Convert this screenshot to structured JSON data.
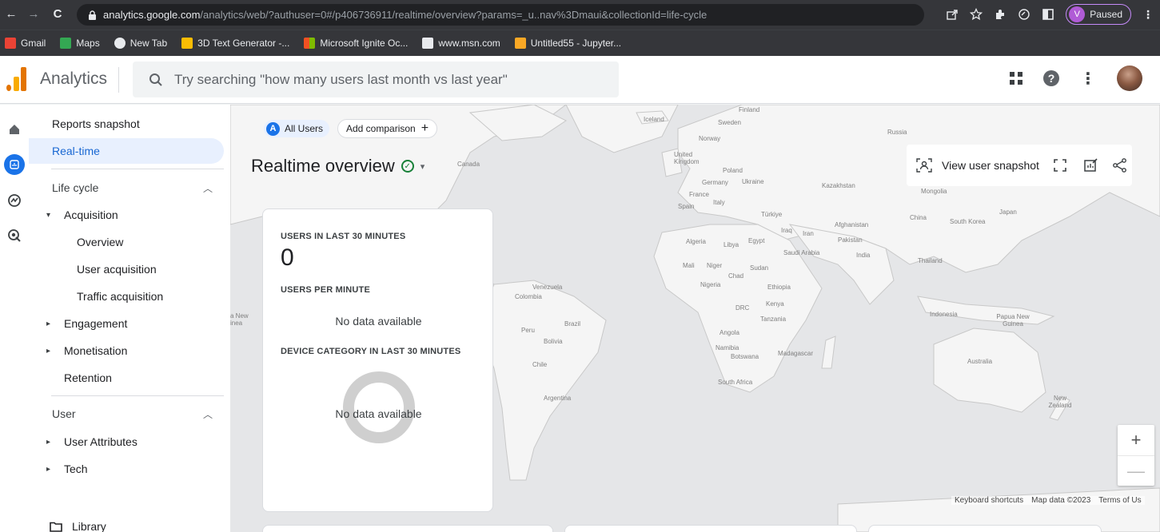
{
  "browser": {
    "nav": {
      "back": "←",
      "forward": "→",
      "reload": "C"
    },
    "url_host": "analytics.google.com",
    "url_path": "/analytics/web/?authuser=0#/p406736911/realtime/overview?params=_u..nav%3Dmaui&collectionId=life-cycle",
    "profile_initial": "V",
    "profile_status": "Paused"
  },
  "bookmarks": [
    {
      "label": "Gmail",
      "color": "#ea4335"
    },
    {
      "label": "Maps",
      "color": "#34a853"
    },
    {
      "label": "New Tab",
      "color": "#e8eaed"
    },
    {
      "label": "3D Text Generator -...",
      "color": "#fbbc04"
    },
    {
      "label": "Microsoft Ignite Oc...",
      "color": "#f25022"
    },
    {
      "label": "www.msn.com",
      "color": "#e8eaed"
    },
    {
      "label": "Untitled55 - Jupyter...",
      "color": "#f9a825"
    }
  ],
  "ga": {
    "title": "Analytics",
    "search_placeholder": "Try searching \"how many users last month vs last year\""
  },
  "sidebar": {
    "reports_snapshot": "Reports snapshot",
    "realtime": "Real-time",
    "lifecycle": "Life cycle",
    "acquisition": "Acquisition",
    "overview": "Overview",
    "user_acquisition": "User acquisition",
    "traffic_acquisition": "Traffic acquisition",
    "engagement": "Engagement",
    "monetisation": "Monetisation",
    "retention": "Retention",
    "user": "User",
    "user_attributes": "User Attributes",
    "tech": "Tech",
    "library": "Library"
  },
  "main": {
    "chip_all_letter": "A",
    "chip_all": "All Users",
    "chip_add": "Add comparison",
    "title": "Realtime overview",
    "view_snapshot": "View user snapshot",
    "card": {
      "users_30": "USERS IN LAST 30 MINUTES",
      "users_30_value": "0",
      "users_per_minute": "USERS PER MINUTE",
      "no_data_1": "No data available",
      "device_category": "DEVICE CATEGORY IN LAST 30 MINUTES",
      "no_data_2": "No data available"
    },
    "attribution": {
      "shortcuts": "Keyboard shortcuts",
      "mapdata": "Map data ©2023",
      "terms": "Terms of Us"
    }
  },
  "map_labels": {
    "iceland": "Iceland",
    "finland": "Finland",
    "sweden": "Sweden",
    "norway": "Norway",
    "russia": "Russia",
    "uk": "United Kingdom",
    "poland": "Poland",
    "germany": "Germany",
    "ukraine": "Ukraine",
    "kazakhstan": "Kazakhstan",
    "france": "France",
    "italy": "Italy",
    "spain": "Spain",
    "mongolia": "Mongolia",
    "turkiye": "Türkiye",
    "canada": "Canada",
    "china": "China",
    "japan": "Japan",
    "south_korea": "South Korea",
    "iraq": "Iraq",
    "iran": "Iran",
    "afghanistan": "Afghanistan",
    "pakistan": "Pakistan",
    "algeria": "Algeria",
    "libya": "Libya",
    "egypt": "Egypt",
    "saudi": "Saudi Arabia",
    "india": "India",
    "thailand": "Thailand",
    "mali": "Mali",
    "niger": "Niger",
    "chad": "Chad",
    "sudan": "Sudan",
    "nigeria": "Nigeria",
    "ethiopia": "Ethiopia",
    "venezuela": "Venezuela",
    "colombia": "Colombia",
    "drc": "DRC",
    "kenya": "Kenya",
    "tanzania": "Tanzania",
    "brazil": "Brazil",
    "peru": "Peru",
    "bolivia": "Bolivia",
    "angola": "Angola",
    "namibia": "Namibia",
    "botswana": "Botswana",
    "madagascar": "Madagascar",
    "indonesia": "Indonesia",
    "png": "Papua New Guinea",
    "chile": "Chile",
    "australia": "Australia",
    "south_africa": "South Africa",
    "argentina": "Argentina",
    "new_zealand": "New Zealand",
    "png_left": "a New inea"
  }
}
